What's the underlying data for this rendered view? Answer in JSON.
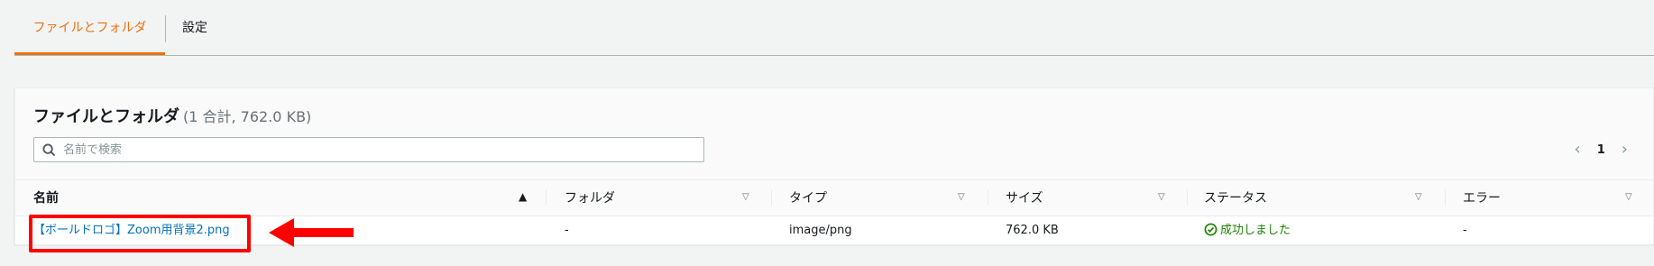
{
  "tabs": [
    {
      "label": "ファイルとフォルダ",
      "active": true
    },
    {
      "label": "設定",
      "active": false
    }
  ],
  "panel": {
    "title": "ファイルとフォルダ",
    "count": "(1 合計, 762.0 KB)"
  },
  "search": {
    "placeholder": "名前で検索",
    "value": ""
  },
  "pagination": {
    "prev": "‹",
    "current": "1",
    "next": "›"
  },
  "table": {
    "columns": [
      "名前",
      "フォルダ",
      "タイプ",
      "サイズ",
      "ステータス",
      "エラー"
    ],
    "sort": {
      "column": "名前",
      "direction": "ascending"
    },
    "rows": [
      {
        "name": "【ボールドロゴ】Zoom用背景2.png",
        "folder": "-",
        "type": "image/png",
        "size": "762.0 KB",
        "status": "成功しました",
        "error": "-"
      }
    ]
  },
  "annotation": {
    "highlight_color": "#ff0000",
    "target": "file name link"
  },
  "colors": {
    "accent": "#ec7211",
    "link": "#0073bb",
    "success": "#1d8102"
  }
}
